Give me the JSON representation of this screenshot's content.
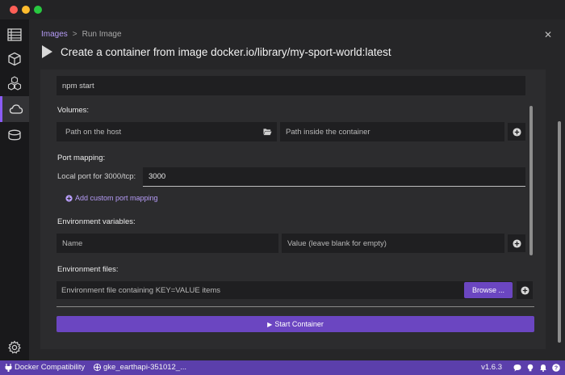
{
  "window": {
    "traffic_lights": [
      "close",
      "minimize",
      "zoom"
    ]
  },
  "sidebar": {
    "items": [
      {
        "icon": "dashboard-icon",
        "active": false
      },
      {
        "icon": "cube-icon",
        "active": false
      },
      {
        "icon": "cubes-icon",
        "active": false
      },
      {
        "icon": "cloud-icon",
        "active": true
      },
      {
        "icon": "database-icon",
        "active": false
      },
      {
        "icon": "gear-icon",
        "active": false
      }
    ]
  },
  "header": {
    "breadcrumb": {
      "link": "Images",
      "separator": ">",
      "current": "Run Image"
    },
    "title": "Create a container from image docker.io/library/my-sport-world:latest",
    "close": "✕"
  },
  "form": {
    "command_value": "npm start",
    "volumes_label": "Volumes:",
    "volume_host_placeholder": "Path on the host",
    "volume_container_placeholder": "Path inside the container",
    "port_mapping_label": "Port mapping:",
    "local_port_label": "Local port for 3000/tcp:",
    "local_port_value": "3000",
    "add_port_link": "Add custom port mapping",
    "env_vars_label": "Environment variables:",
    "env_name_placeholder": "Name",
    "env_value_placeholder": "Value (leave blank for empty)",
    "env_files_label": "Environment files:",
    "env_file_placeholder": "Environment file containing KEY=VALUE items",
    "browse_label": "Browse ...",
    "start_label": "Start Container"
  },
  "statusbar": {
    "compat": "Docker Compatibility",
    "context": "gke_earthapi-351012_...",
    "version": "v1.6.3"
  },
  "colors": {
    "accent": "#6b46c1",
    "link": "#b69cf7",
    "statusbar": "#5b3fab"
  }
}
